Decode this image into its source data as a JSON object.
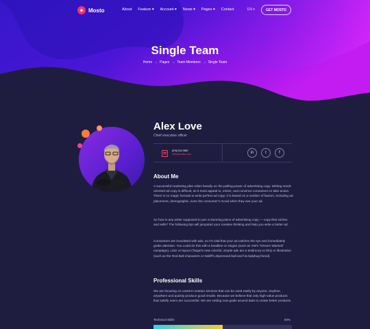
{
  "brand": {
    "name": "Mosto"
  },
  "nav": {
    "items": [
      "About",
      "Feature ▾",
      "Account ▾",
      "News ▾",
      "Pages ▾",
      "Contact"
    ],
    "lang": "EN ▾",
    "cta": "GET MOSTO"
  },
  "hero": {
    "title": "Single Team",
    "breadcrumb": [
      "Home",
      "Pages",
      "Team Members",
      "Single Team"
    ],
    "sep": "→"
  },
  "profile": {
    "name": "Alex Love",
    "role": "Chief executive officer",
    "phone": "(076) 512 9987",
    "email": "hello@mosto.com",
    "social": [
      "in",
      "t",
      "f"
    ]
  },
  "about": {
    "heading": "About Me",
    "p1": "A successful marketing plan relies heavily on the pulling-power of advertising copy. Writing result-oriented ad copy is difficult, as it must appeal to, entice, and convince consumers to take action. There is no magic formula to write perfect ad copy; it is based on a number of factors, including ad placement, demographic, even the consumer's mood when they see your ad.",
    "p2": "So how is any writer supposed to pen a stunning piece of advertising copy — copy that sizzles and sells? The following tips will jumpstart your creative thinking and help you write a better ad.",
    "p3": "Consumers are inundated with ads, so it's vital that your ad catches the eye and immediately grabs attention. You could do this with a headline or slogan (such as VW's \"Drivers Wanted\" campaign), color or layout (Target's new colorful, simple ads are a testimony to this) or illustration (such as the Red Bull characters or Dabff's depressed ball and his ladybug friend)."
  },
  "skills": {
    "heading": "Professional Skills",
    "p": "We are focusing on content creation services that can be used easily by anyone, anytime, anywhere and quickly produce good results. Because we believe that only high-value products that satisfy users are successful. We are setting new goals around data to create better products.",
    "items": [
      {
        "label": "Technical Skills",
        "pct": "50%",
        "value": 50
      }
    ]
  },
  "colors": {
    "accent": "#ff3d6e",
    "background": "#1e1d3f",
    "hero_start": "#3a1ad8",
    "hero_end": "#b31cf0"
  }
}
